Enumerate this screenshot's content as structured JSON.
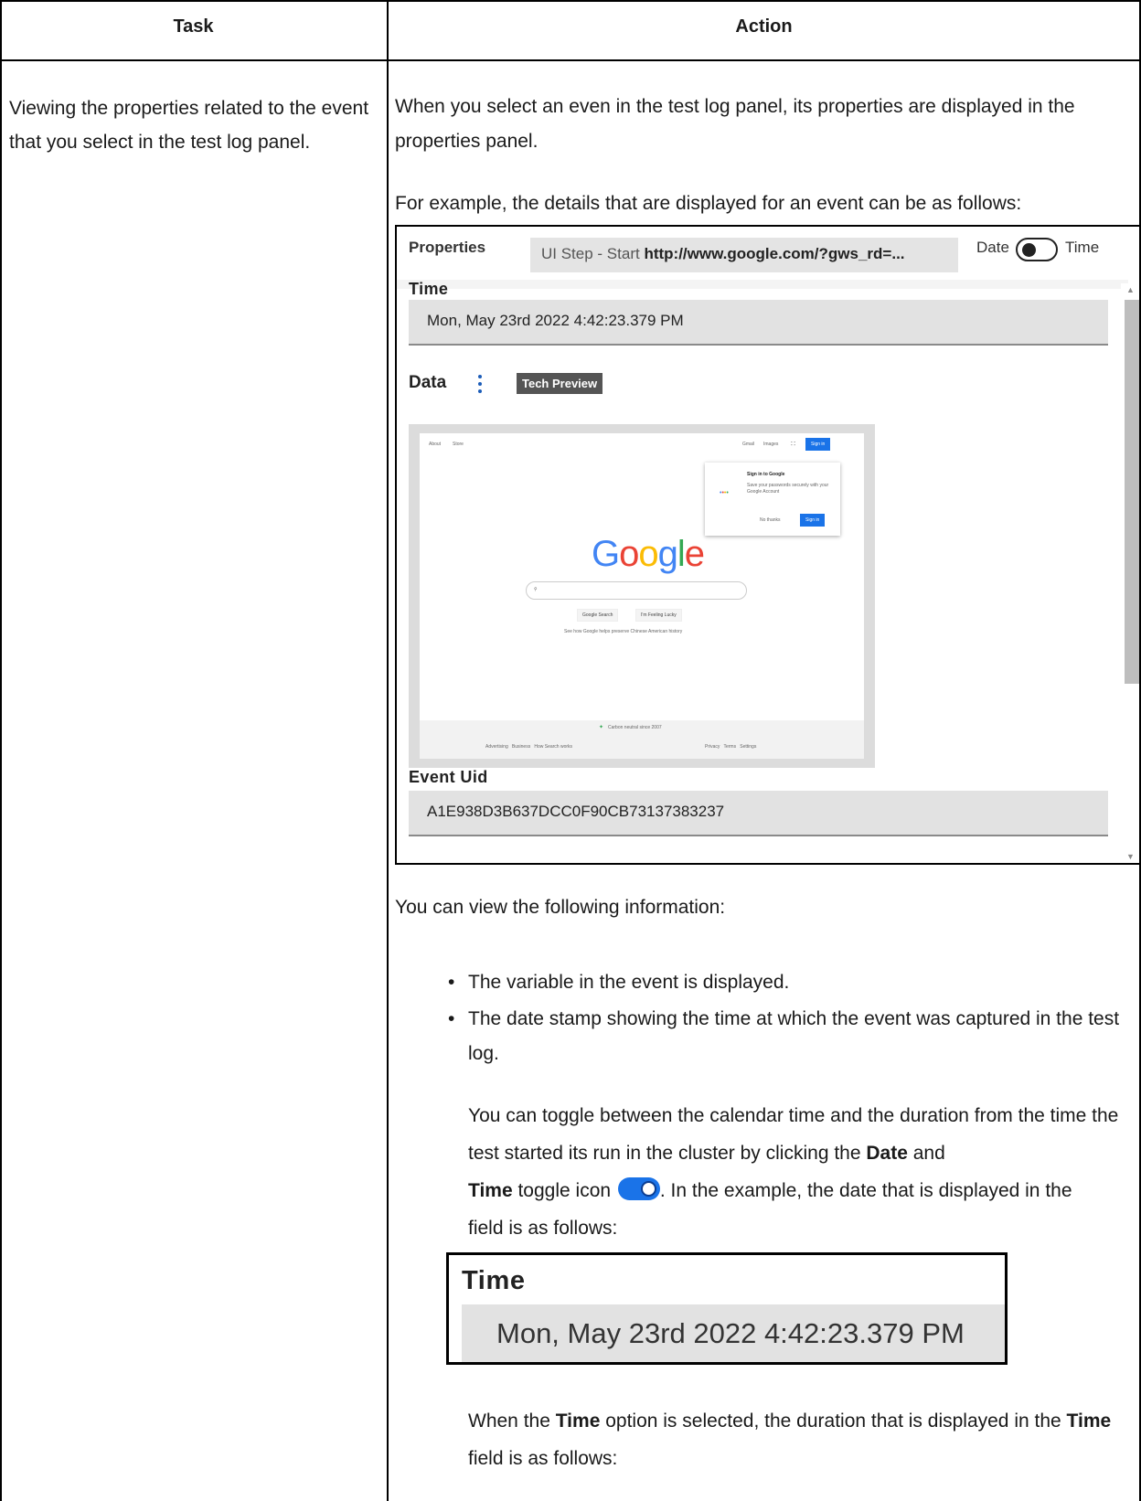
{
  "table": {
    "header_task": "Task",
    "header_action": "Action",
    "task_text": "Viewing the properties related to the event that you select in the test log panel."
  },
  "action": {
    "intro": "When you select an even in the test log panel, its properties are displayed in the properties panel.",
    "example_intro": "For example, the details that are displayed for an event can be as follows:",
    "view_info": "You can view the following information:",
    "bullet_1": "The variable in the event is displayed.",
    "bullet_2": "The date stamp showing the time at which the event was captured in the test log.",
    "toggle_p1": "You can toggle between the calendar time and the duration from the time the test started its run in the cluster by clicking the ",
    "toggle_date": "Date",
    "toggle_and": " and",
    "toggle_time": "Time",
    "toggle_p2": " toggle icon ",
    "toggle_p3": ". In the example, the date that is displayed in the ",
    "toggle_time2": "Time",
    "toggle_p4": " field is as follows:",
    "when_p1": "When the ",
    "when_time": "Time",
    "when_p2": " option is selected, the duration that is displayed in the ",
    "when_time2": "Time",
    "when_p3": " field is as follows:"
  },
  "panel": {
    "title": "Properties",
    "tab_prefix": "UI Step - Start ",
    "tab_url": "http://www.google.com/?gws_rd=...",
    "toggle_left": "Date",
    "toggle_right": "Time",
    "time_label": "Time",
    "time_value": "Mon, May 23rd 2022 4:42:23.379 PM",
    "data_label": "Data",
    "badge": "Tech Preview",
    "uid_label": "Event Uid",
    "uid_value": "A1E938D3B637DCC0F90CB73137383237"
  },
  "google": {
    "about": "About",
    "store": "Store",
    "gmail": "Gmail",
    "images": "Images",
    "sign_in": "Sign in",
    "popup_title": "Sign in to Google",
    "popup_text": "Save your passwords securely with your Google Account",
    "no_thanks": "No thanks",
    "search_btn": "Google Search",
    "lucky_btn": "I'm Feeling Lucky",
    "helps": "See how Google helps preserve Chinese American history",
    "carbon": "Carbon neutral since 2007",
    "foot_left": "Advertising   Business   How Search works",
    "foot_right": "Privacy   Terms   Settings"
  },
  "zoom": {
    "label": "Time",
    "value": "Mon, May 23rd 2022 4:42:23.379 PM"
  }
}
